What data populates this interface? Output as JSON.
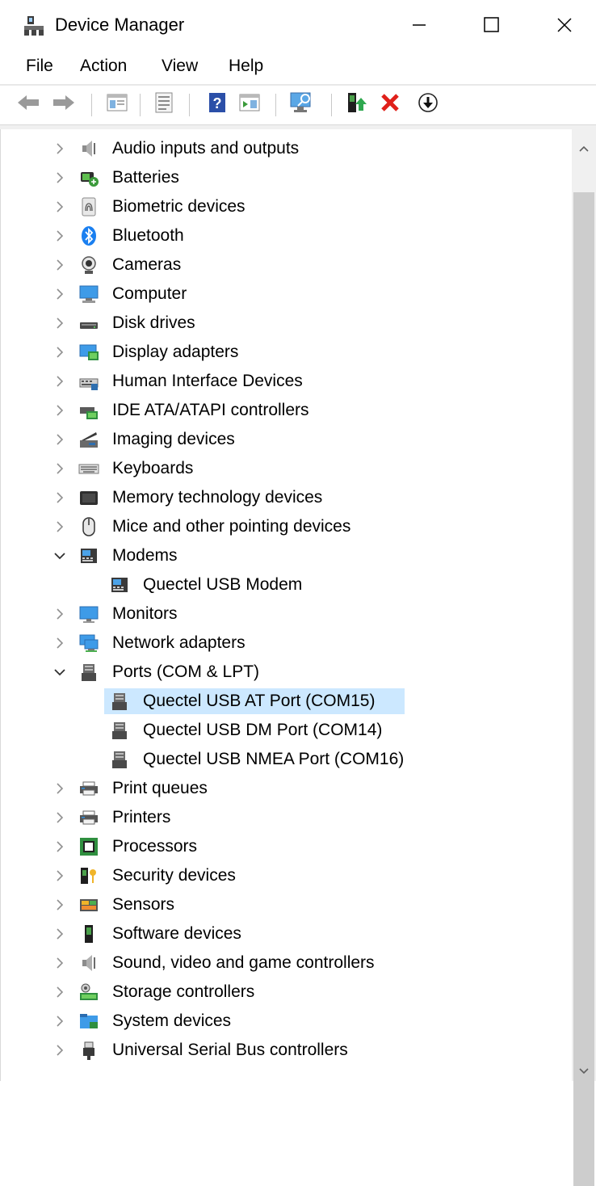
{
  "window": {
    "title": "Device Manager"
  },
  "menu": [
    "File",
    "Action",
    "View",
    "Help"
  ],
  "toolbar": [
    {
      "name": "back-button",
      "icon": "back-arrow-icon"
    },
    {
      "name": "forward-button",
      "icon": "forward-arrow-icon"
    },
    {
      "name": "show-hide-console-tree-button",
      "icon": "console-tree-icon"
    },
    {
      "name": "properties-button",
      "icon": "properties-icon"
    },
    {
      "name": "help-button",
      "icon": "help-icon"
    },
    {
      "name": "show-action-pane-button",
      "icon": "action-pane-icon"
    },
    {
      "name": "scan-hardware-button",
      "icon": "monitor-scan-icon"
    },
    {
      "name": "update-driver-button",
      "icon": "update-driver-icon"
    },
    {
      "name": "uninstall-device-button",
      "icon": "red-x-icon"
    },
    {
      "name": "disable-device-button",
      "icon": "down-arrow-circle-icon"
    }
  ],
  "tree": [
    {
      "label": "Audio inputs and outputs",
      "icon": "speaker-icon",
      "level": 0,
      "state": "collapsed"
    },
    {
      "label": "Batteries",
      "icon": "battery-icon",
      "level": 0,
      "state": "collapsed"
    },
    {
      "label": "Biometric devices",
      "icon": "fingerprint-icon",
      "level": 0,
      "state": "collapsed"
    },
    {
      "label": "Bluetooth",
      "icon": "bluetooth-icon",
      "level": 0,
      "state": "collapsed"
    },
    {
      "label": "Cameras",
      "icon": "camera-icon",
      "level": 0,
      "state": "collapsed"
    },
    {
      "label": "Computer",
      "icon": "computer-icon",
      "level": 0,
      "state": "collapsed"
    },
    {
      "label": "Disk drives",
      "icon": "disk-drive-icon",
      "level": 0,
      "state": "collapsed"
    },
    {
      "label": "Display adapters",
      "icon": "display-adapter-icon",
      "level": 0,
      "state": "collapsed"
    },
    {
      "label": "Human Interface Devices",
      "icon": "hid-icon",
      "level": 0,
      "state": "collapsed"
    },
    {
      "label": "IDE ATA/ATAPI controllers",
      "icon": "ide-controller-icon",
      "level": 0,
      "state": "collapsed"
    },
    {
      "label": "Imaging devices",
      "icon": "scanner-icon",
      "level": 0,
      "state": "collapsed"
    },
    {
      "label": "Keyboards",
      "icon": "keyboard-icon",
      "level": 0,
      "state": "collapsed"
    },
    {
      "label": "Memory technology devices",
      "icon": "memory-card-icon",
      "level": 0,
      "state": "collapsed"
    },
    {
      "label": "Mice and other pointing devices",
      "icon": "mouse-icon",
      "level": 0,
      "state": "collapsed"
    },
    {
      "label": "Modems",
      "icon": "modem-icon",
      "level": 0,
      "state": "expanded"
    },
    {
      "label": "Quectel USB Modem",
      "icon": "modem-icon",
      "level": 1,
      "state": "leaf"
    },
    {
      "label": "Monitors",
      "icon": "monitor-icon",
      "level": 0,
      "state": "collapsed"
    },
    {
      "label": "Network adapters",
      "icon": "network-adapter-icon",
      "level": 0,
      "state": "collapsed"
    },
    {
      "label": "Ports (COM & LPT)",
      "icon": "port-icon",
      "level": 0,
      "state": "expanded"
    },
    {
      "label": "Quectel USB AT Port (COM15)",
      "icon": "port-icon",
      "level": 1,
      "state": "leaf",
      "selected": true
    },
    {
      "label": "Quectel USB DM Port (COM14)",
      "icon": "port-icon",
      "level": 1,
      "state": "leaf"
    },
    {
      "label": "Quectel USB NMEA Port (COM16)",
      "icon": "port-icon",
      "level": 1,
      "state": "leaf"
    },
    {
      "label": "Print queues",
      "icon": "printer-icon",
      "level": 0,
      "state": "collapsed"
    },
    {
      "label": "Printers",
      "icon": "printer-icon",
      "level": 0,
      "state": "collapsed"
    },
    {
      "label": "Processors",
      "icon": "processor-icon",
      "level": 0,
      "state": "collapsed"
    },
    {
      "label": "Security devices",
      "icon": "security-key-icon",
      "level": 0,
      "state": "collapsed"
    },
    {
      "label": "Sensors",
      "icon": "sensor-icon",
      "level": 0,
      "state": "collapsed"
    },
    {
      "label": "Software devices",
      "icon": "software-device-icon",
      "level": 0,
      "state": "collapsed"
    },
    {
      "label": "Sound, video and game controllers",
      "icon": "speaker-icon",
      "level": 0,
      "state": "collapsed"
    },
    {
      "label": "Storage controllers",
      "icon": "storage-controller-icon",
      "level": 0,
      "state": "collapsed"
    },
    {
      "label": "System devices",
      "icon": "system-folder-icon",
      "level": 0,
      "state": "collapsed"
    },
    {
      "label": "Universal Serial Bus controllers",
      "icon": "usb-plug-icon",
      "level": 0,
      "state": "collapsed"
    }
  ],
  "colors": {
    "selection": "#cce8ff",
    "scroll_thumb": "#cdcdcd",
    "scroll_track": "#f0f0f0"
  }
}
